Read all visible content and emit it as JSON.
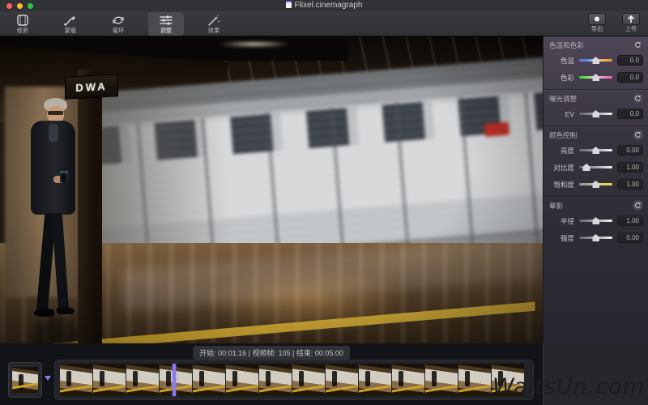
{
  "window": {
    "title": "Flixel.cinemagraph"
  },
  "toolbar": {
    "tools": [
      {
        "id": "trim",
        "label": "修剪",
        "icon": "trim-icon",
        "selected": false
      },
      {
        "id": "mask",
        "label": "蒙版",
        "icon": "mask-brush-icon",
        "selected": false
      },
      {
        "id": "loop",
        "label": "循环",
        "icon": "loop-icon",
        "selected": false
      },
      {
        "id": "adjust",
        "label": "调整",
        "icon": "adjust-sliders-icon",
        "selected": true
      },
      {
        "id": "effects",
        "label": "效果",
        "icon": "effects-wand-icon",
        "selected": false
      }
    ],
    "actions": [
      {
        "id": "export",
        "label": "导出",
        "icon": "export-icon"
      },
      {
        "id": "upload",
        "label": "上传",
        "icon": "upload-icon"
      }
    ]
  },
  "adjust_panel": {
    "sections": [
      {
        "title": "色温和色彩",
        "reset_icon": "reset-icon",
        "rows": [
          {
            "label": "色温",
            "value": "0.0",
            "track": "temperature",
            "handle_pos": 0.5
          },
          {
            "label": "色彩",
            "value": "0.0",
            "track": "tint",
            "handle_pos": 0.5
          }
        ]
      },
      {
        "title": "曝光调整",
        "reset_icon": "reset-icon",
        "rows": [
          {
            "label": "EV",
            "value": "0.0",
            "track": "neutral",
            "handle_pos": 0.5
          }
        ]
      },
      {
        "title": "颜色控制",
        "reset_icon": "reset-icon",
        "rows": [
          {
            "label": "亮度",
            "value": "0.00",
            "track": "neutral",
            "handle_pos": 0.5
          },
          {
            "label": "对比度",
            "value": "1.00",
            "track": "neutral",
            "handle_pos": 0.22
          },
          {
            "label": "饱和度",
            "value": "1.00",
            "track": "saturation",
            "handle_pos": 0.5
          }
        ]
      },
      {
        "title": "晕影",
        "reset_icon": "reset-icon",
        "rows": [
          {
            "label": "半径",
            "value": "1.00",
            "track": "neutral",
            "handle_pos": 0.5
          },
          {
            "label": "强度",
            "value": "0.00",
            "track": "neutral",
            "handle_pos": 0.5
          }
        ]
      }
    ]
  },
  "viewer": {
    "sign_text": "DWA"
  },
  "timeline": {
    "info": "开始: 00:01:16 | 视频帧: 105 | 结束: 00:05:00",
    "thumbnail_count": 14,
    "playhead_position": 0.24
  },
  "watermark": "WaitsUn.com",
  "colors": {
    "accent_purple": "#8a7af0",
    "platform_yellow": "#d8a52c",
    "panel_top": "#4d4656",
    "train_red_badge": "#bf2f27"
  }
}
